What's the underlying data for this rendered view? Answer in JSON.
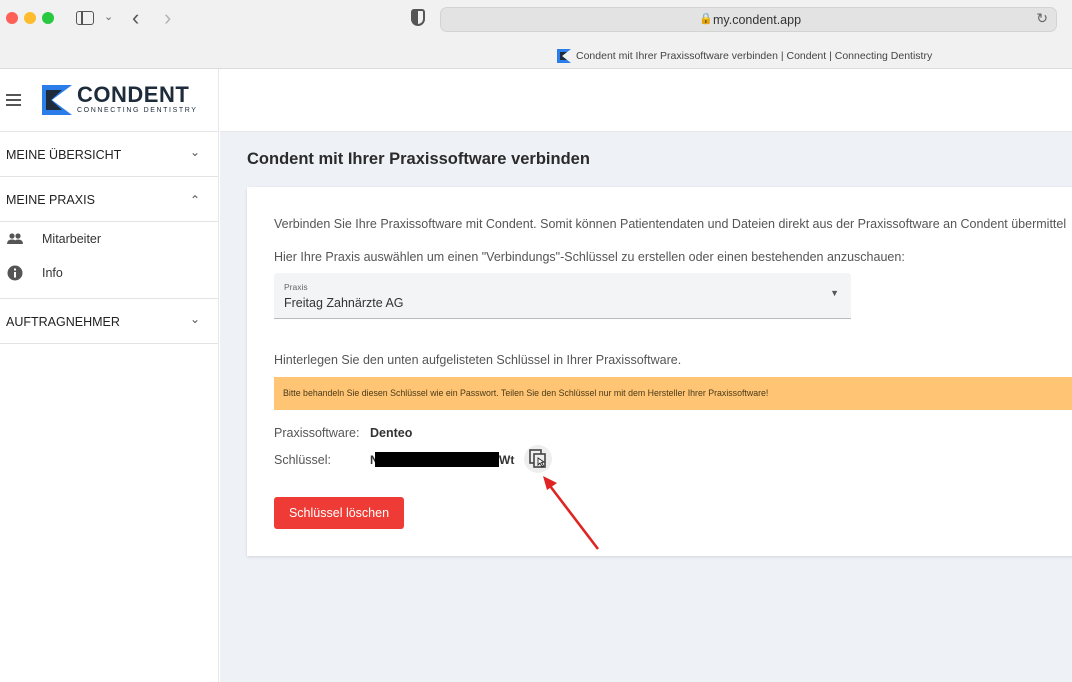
{
  "browser": {
    "url": "my.condent.app",
    "tab_title": "Condent mit Ihrer Praxissoftware verbinden | Condent | Connecting Dentistry"
  },
  "brand": {
    "name": "CONDENT",
    "tagline": "CONNECTING DENTISTRY",
    "color": "#1d2b3a",
    "accent": "#2b7de9"
  },
  "sidebar": {
    "sections": [
      {
        "label": "MEINE ÜBERSICHT"
      },
      {
        "label": "MEINE PRAXIS"
      },
      {
        "label": "AUFTRAGNEHMER"
      }
    ],
    "praxis_items": [
      {
        "label": "Mitarbeiter",
        "icon": "people-icon"
      },
      {
        "label": "Info",
        "icon": "info-icon"
      }
    ]
  },
  "main": {
    "title": "Condent mit Ihrer Praxissoftware verbinden",
    "intro": "Verbinden Sie Ihre Praxissoftware mit Condent. Somit können Patientendaten und Dateien direkt aus der Praxissoftware an Condent übermittel",
    "select_hint": "Hier Ihre Praxis auswählen um einen \"Verbindungs\"-Schlüssel zu erstellen oder einen bestehenden anzuschauen:",
    "praxis_select": {
      "label": "Praxis",
      "value": "Freitag Zahnärzte AG"
    },
    "key_hint": "Hinterlegen Sie den unten aufgelisteten Schlüssel in Ihrer Praxissoftware.",
    "warning": "Bitte behandeln Sie diesen Schlüssel wie ein Passwort. Teilen Sie den Schlüssel nur mit dem Hersteller Ihrer Praxissoftware!",
    "software_label": "Praxissoftware:",
    "software_value": "Denteo",
    "key_label": "Schlüssel:",
    "key_start": "N",
    "key_end": "Wt",
    "delete_button": "Schlüssel löschen",
    "warning_color": "#ffc574",
    "danger_color": "#ee3b35"
  }
}
